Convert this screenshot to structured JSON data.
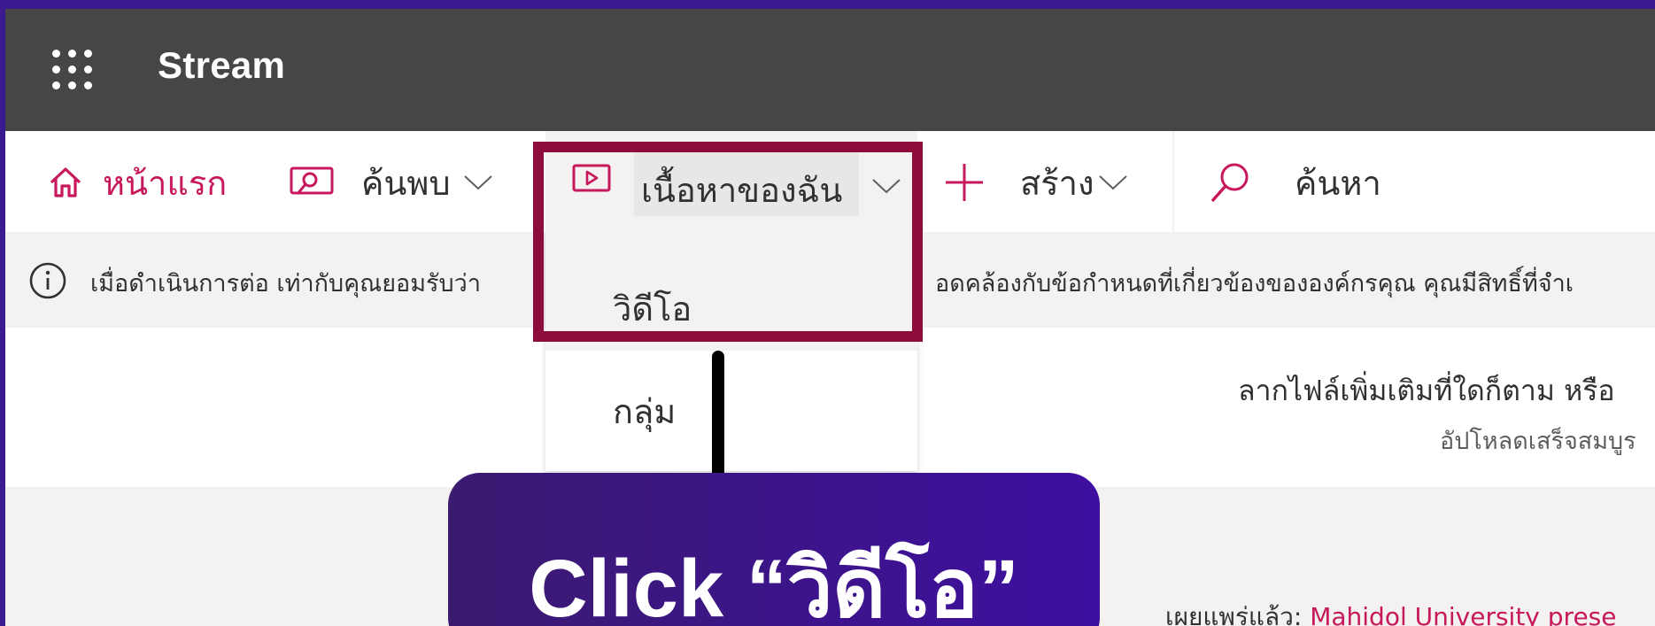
{
  "app": {
    "title": "Stream"
  },
  "nav": {
    "home": "หน้าแรก",
    "discover": "ค้นพบ",
    "my_content": "เนื้อหาของฉัน",
    "create": "สร้าง",
    "search": "ค้นหา"
  },
  "dropdown": {
    "items": [
      "วิดีโอ",
      "กลุ่ม"
    ]
  },
  "banner": {
    "text_left": "เมื่อดำเนินการต่อ เท่ากับคุณยอมรับว่า",
    "text_right": "อดคล้องกับข้อกำหนดที่เกี่ยวข้องขององค์กรคุณ คุณมีสิทธิ์ที่จำเ"
  },
  "upload": {
    "main_text": "ลากไฟล์เพิ่มเติมที่ใดก็ตาม หรือ",
    "sub_text": "อัปโหลดเสร็จสมบูร"
  },
  "published": {
    "label": "เผยแพร่แล้ว:",
    "org": "Mahidol University prese"
  },
  "callout": {
    "text": "Click “วิดีโอ”"
  },
  "colors": {
    "accent": "#c7185b",
    "highlight": "#8e0c3b",
    "callout": "#3e0fa0",
    "topbar": "#484644"
  }
}
